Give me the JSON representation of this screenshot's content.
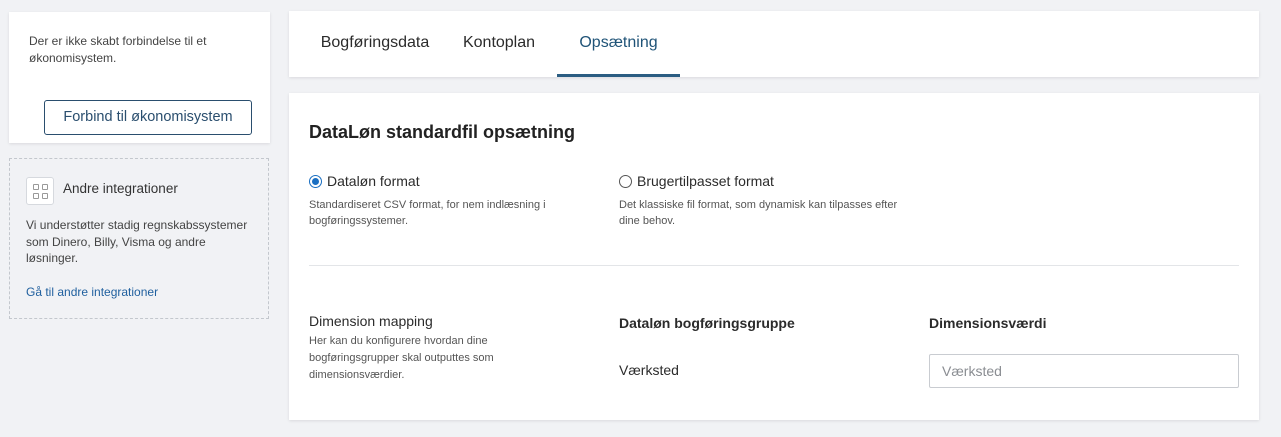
{
  "connection": {
    "message": "Der er ikke skabt forbindelse til et økonomisystem.",
    "button_label": "Forbind til økonomisystem"
  },
  "other_integrations": {
    "icon": "grid-icon",
    "title": "Andre integrationer",
    "description": "Vi understøtter stadig regnskabssystemer som Dinero, Billy, Visma og andre løsninger.",
    "link_label": "Gå til andre integrationer"
  },
  "tabs": [
    {
      "label": "Bogføringsdata",
      "active": false
    },
    {
      "label": "Kontoplan",
      "active": false
    },
    {
      "label": "Opsætning",
      "active": true
    }
  ],
  "main": {
    "heading": "DataLøn standardfil opsætning",
    "format_options": [
      {
        "label": "Dataløn format",
        "checked": true,
        "description": "Standardiseret CSV format, for nem indlæsning i bogføringssystemer."
      },
      {
        "label": "Brugertilpasset format",
        "checked": false,
        "description": "Det klassiske fil format, som dynamisk kan tilpasses efter dine behov."
      }
    ],
    "dimension_mapping": {
      "title": "Dimension mapping",
      "description": "Her kan du konfigurere hvordan dine bogføringsgrupper skal outputtes som dimensionsværdier.",
      "group_header": "Dataløn bogføringsgruppe",
      "value_header": "Dimensionsværdi",
      "rows": [
        {
          "group": "Værksted",
          "value": "",
          "placeholder": "Værksted"
        }
      ]
    }
  },
  "colors": {
    "accent": "#2b5d82",
    "radio_selected": "#1a6fc2",
    "link": "#1f5f9e",
    "background": "#f1f2f5"
  }
}
